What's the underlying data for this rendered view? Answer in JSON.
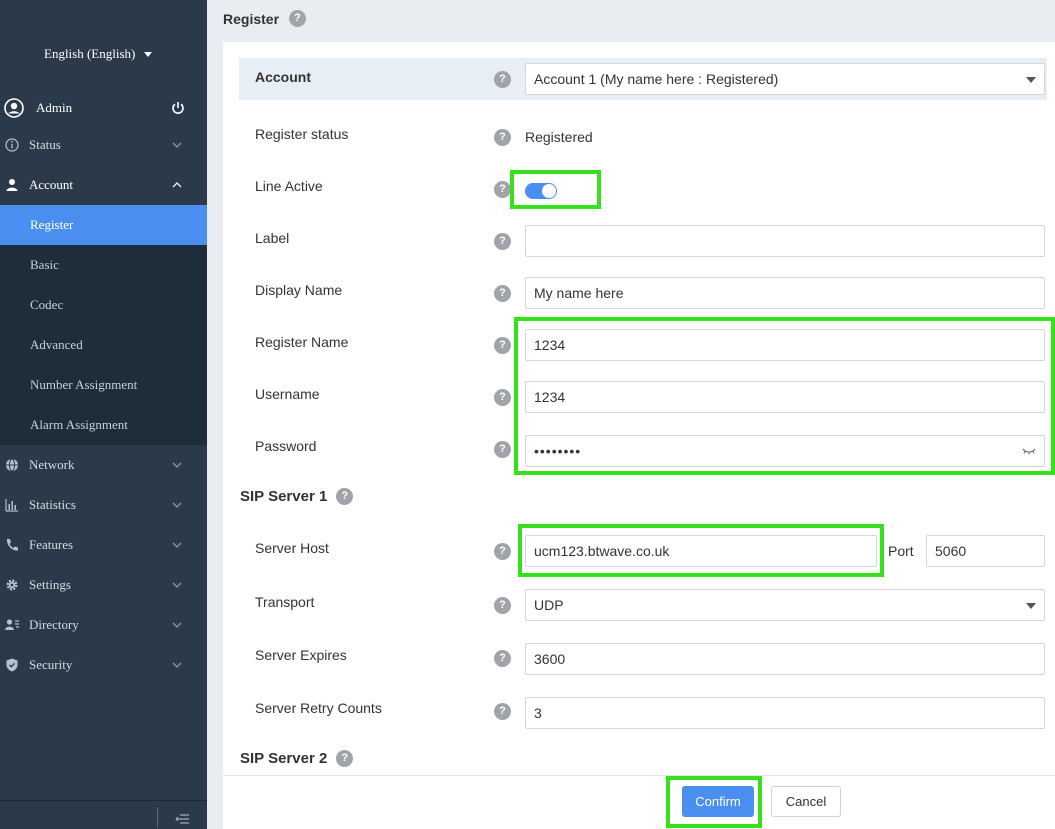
{
  "sidebar": {
    "language": "English (English)",
    "user": "Admin",
    "menu": [
      {
        "label": "Status",
        "icon": "info-icon"
      },
      {
        "label": "Account",
        "icon": "user-icon",
        "expanded": true,
        "subitems": [
          "Register",
          "Basic",
          "Codec",
          "Advanced",
          "Number Assignment",
          "Alarm Assignment"
        ],
        "active_subitem": "Register"
      },
      {
        "label": "Network",
        "icon": "globe-icon"
      },
      {
        "label": "Statistics",
        "icon": "bar-chart-icon"
      },
      {
        "label": "Features",
        "icon": "phone-icon"
      },
      {
        "label": "Settings",
        "icon": "gear-icon"
      },
      {
        "label": "Directory",
        "icon": "contacts-icon"
      },
      {
        "label": "Security",
        "icon": "shield-icon"
      }
    ]
  },
  "page": {
    "title": "Register",
    "account": {
      "label": "Account",
      "value": "Account 1 (My name here : Registered)"
    },
    "register_status": {
      "label": "Register status",
      "value": "Registered"
    },
    "line_active": {
      "label": "Line Active",
      "on": true
    },
    "label_field": {
      "label": "Label",
      "value": ""
    },
    "display_name": {
      "label": "Display Name",
      "value": "My name here"
    },
    "register_name": {
      "label": "Register Name",
      "value": "1234"
    },
    "username": {
      "label": "Username",
      "value": "1234"
    },
    "password": {
      "label": "Password",
      "value": "••••••••"
    },
    "sip_server_1": {
      "title": "SIP Server 1",
      "server_host": {
        "label": "Server Host",
        "value": "ucm123.btwave.co.uk"
      },
      "port": {
        "label": "Port",
        "value": "5060"
      },
      "transport": {
        "label": "Transport",
        "value": "UDP"
      },
      "server_expires": {
        "label": "Server Expires",
        "value": "3600"
      },
      "server_retry_counts": {
        "label": "Server Retry Counts",
        "value": "3"
      }
    },
    "sip_server_2": {
      "title": "SIP Server 2"
    },
    "buttons": {
      "confirm": "Confirm",
      "cancel": "Cancel"
    },
    "help_icon": "?"
  },
  "colors": {
    "sidebar_bg": "#2a3a4b",
    "submenu_bg": "#1f2c3a",
    "accent": "#4a8ff0",
    "highlight": "#36e01a"
  }
}
